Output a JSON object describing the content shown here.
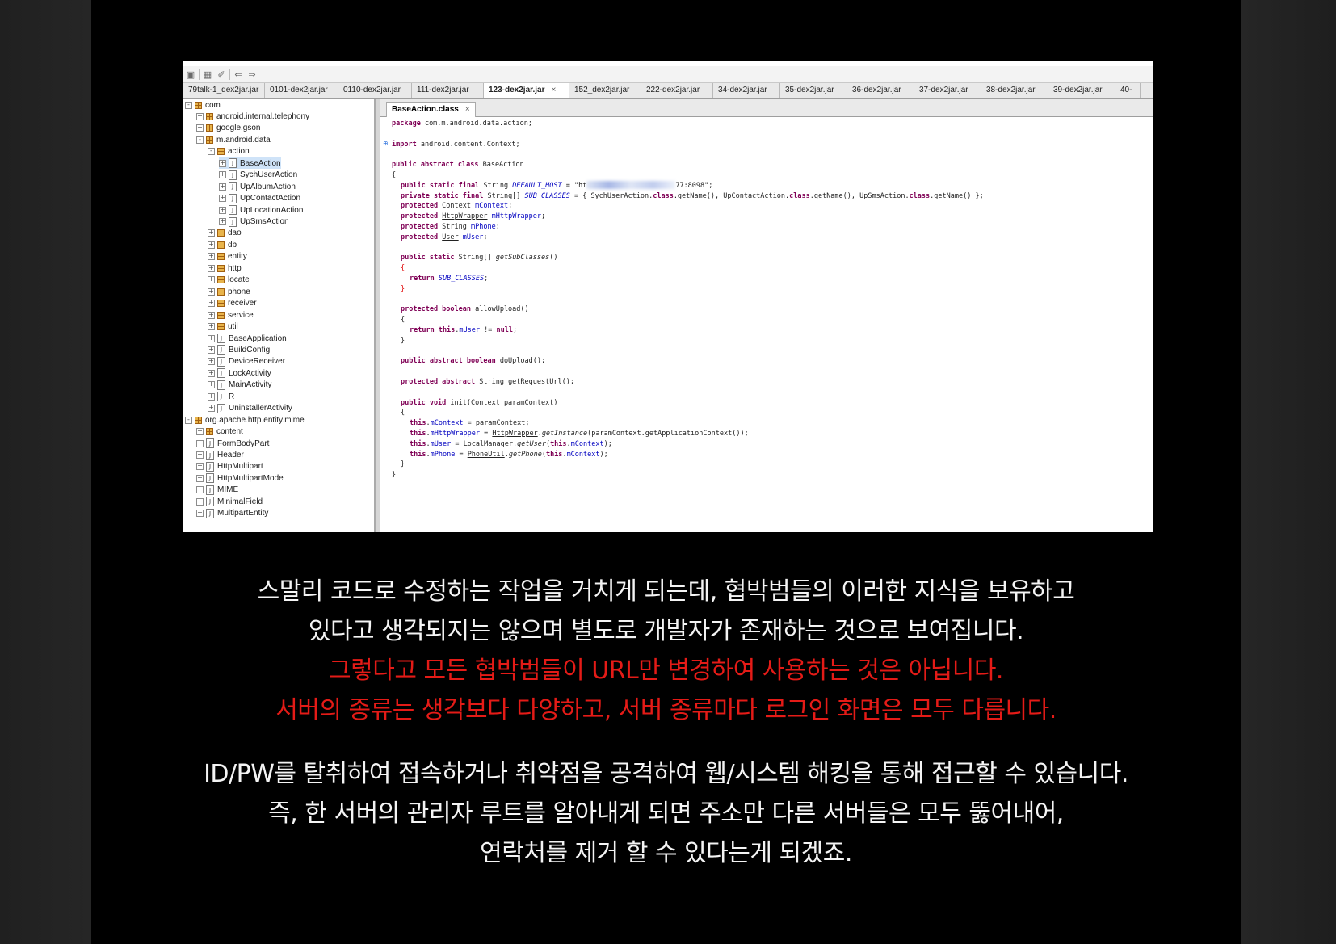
{
  "toolbar_icons": [
    "open-icon",
    "save-all-icon",
    "tool-icon",
    "back-arrow-icon",
    "forward-arrow-icon"
  ],
  "tabs": [
    {
      "label": "79talk-1_dex2jar.jar",
      "active": false
    },
    {
      "label": "0101-dex2jar.jar",
      "active": false
    },
    {
      "label": "0110-dex2jar.jar",
      "active": false
    },
    {
      "label": "111-dex2jar.jar",
      "active": false
    },
    {
      "label": "123-dex2jar.jar",
      "active": true
    },
    {
      "label": "152_dex2jar.jar",
      "active": false
    },
    {
      "label": "222-dex2jar.jar",
      "active": false
    },
    {
      "label": "34-dex2jar.jar",
      "active": false
    },
    {
      "label": "35-dex2jar.jar",
      "active": false
    },
    {
      "label": "36-dex2jar.jar",
      "active": false
    },
    {
      "label": "37-dex2jar.jar",
      "active": false
    },
    {
      "label": "38-dex2jar.jar",
      "active": false
    },
    {
      "label": "39-dex2jar.jar",
      "active": false
    },
    {
      "label": "40-",
      "active": false
    }
  ],
  "tree": [
    {
      "label": "com",
      "type": "pkg",
      "exp": "-",
      "lvl": 0
    },
    {
      "label": "android.internal.telephony",
      "type": "pkg",
      "exp": "+",
      "lvl": 1
    },
    {
      "label": "google.gson",
      "type": "pkg",
      "exp": "+",
      "lvl": 1
    },
    {
      "label": "m.android.data",
      "type": "pkg",
      "exp": "-",
      "lvl": 1
    },
    {
      "label": "action",
      "type": "pkg",
      "exp": "-",
      "lvl": 2
    },
    {
      "label": "BaseAction",
      "type": "cls",
      "exp": "+",
      "lvl": 3,
      "selected": true
    },
    {
      "label": "SychUserAction",
      "type": "cls",
      "exp": "+",
      "lvl": 3
    },
    {
      "label": "UpAlbumAction",
      "type": "cls",
      "exp": "+",
      "lvl": 3
    },
    {
      "label": "UpContactAction",
      "type": "cls",
      "exp": "+",
      "lvl": 3
    },
    {
      "label": "UpLocationAction",
      "type": "cls",
      "exp": "+",
      "lvl": 3
    },
    {
      "label": "UpSmsAction",
      "type": "cls",
      "exp": "+",
      "lvl": 3
    },
    {
      "label": "dao",
      "type": "pkg",
      "exp": "+",
      "lvl": 2
    },
    {
      "label": "db",
      "type": "pkg",
      "exp": "+",
      "lvl": 2
    },
    {
      "label": "entity",
      "type": "pkg",
      "exp": "+",
      "lvl": 2
    },
    {
      "label": "http",
      "type": "pkg",
      "exp": "+",
      "lvl": 2
    },
    {
      "label": "locate",
      "type": "pkg",
      "exp": "+",
      "lvl": 2
    },
    {
      "label": "phone",
      "type": "pkg",
      "exp": "+",
      "lvl": 2
    },
    {
      "label": "receiver",
      "type": "pkg",
      "exp": "+",
      "lvl": 2
    },
    {
      "label": "service",
      "type": "pkg",
      "exp": "+",
      "lvl": 2
    },
    {
      "label": "util",
      "type": "pkg",
      "exp": "+",
      "lvl": 2
    },
    {
      "label": "BaseApplication",
      "type": "cls",
      "exp": "+",
      "lvl": 2
    },
    {
      "label": "BuildConfig",
      "type": "cls",
      "exp": "+",
      "lvl": 2
    },
    {
      "label": "DeviceReceiver",
      "type": "cls",
      "exp": "+",
      "lvl": 2
    },
    {
      "label": "LockActivity",
      "type": "cls",
      "exp": "+",
      "lvl": 2
    },
    {
      "label": "MainActivity",
      "type": "cls",
      "exp": "+",
      "lvl": 2
    },
    {
      "label": "R",
      "type": "cls",
      "exp": "+",
      "lvl": 2
    },
    {
      "label": "UninstallerActivity",
      "type": "cls",
      "exp": "+",
      "lvl": 2
    },
    {
      "label": "org.apache.http.entity.mime",
      "type": "pkg",
      "exp": "-",
      "lvl": 0
    },
    {
      "label": "content",
      "type": "pkg",
      "exp": "+",
      "lvl": 1
    },
    {
      "label": "FormBodyPart",
      "type": "cls",
      "exp": "+",
      "lvl": 1
    },
    {
      "label": "Header",
      "type": "cls",
      "exp": "+",
      "lvl": 1
    },
    {
      "label": "HttpMultipart",
      "type": "cls",
      "exp": "+",
      "lvl": 1
    },
    {
      "label": "HttpMultipartMode",
      "type": "cls",
      "exp": "+",
      "lvl": 1
    },
    {
      "label": "MIME",
      "type": "cls",
      "exp": "+",
      "lvl": 1
    },
    {
      "label": "MinimalField",
      "type": "cls",
      "exp": "+",
      "lvl": 1
    },
    {
      "label": "MultipartEntity",
      "type": "cls",
      "exp": "+",
      "lvl": 1
    }
  ],
  "editor_tab": "BaseAction.class",
  "code_lines": [
    {
      "n": 0,
      "ind": 0,
      "html": "<span class=\"kw\">package</span> com.m.android.data.action;"
    },
    {
      "n": 2,
      "ind": 0,
      "html": "<span class=\"kw\">import</span> android.content.Context;",
      "fold": true
    },
    {
      "n": 4,
      "ind": 0,
      "html": "<span class=\"kw\">public abstract class</span> BaseAction"
    },
    {
      "n": 5,
      "ind": 0,
      "html": "{"
    },
    {
      "n": 6,
      "ind": 1,
      "html": "<span class=\"kw\">public static final</span> String <span class=\"it\">DEFAULT_HOST</span> = \"ht<span class=\"blur\"></span>77:8098\";"
    },
    {
      "n": 7,
      "ind": 1,
      "html": "<span class=\"kw\">private static final</span> String[] <span class=\"it\">SUB_CLASSES</span> = { <span class=\"ty\">SychUserAction</span>.<span class=\"kw\">class</span>.getName(), <span class=\"ty\">UpContactAction</span>.<span class=\"kw\">class</span>.getName(), <span class=\"ty\">UpSmsAction</span>.<span class=\"kw\">class</span>.getName() };"
    },
    {
      "n": 8,
      "ind": 1,
      "html": "<span class=\"kw\">protected</span> Context <span class=\"fld\">mContext</span>;"
    },
    {
      "n": 9,
      "ind": 1,
      "html": "<span class=\"kw\">protected</span> <span class=\"ty\">HttpWrapper</span> <span class=\"fld\">mHttpWrapper</span>;"
    },
    {
      "n": 10,
      "ind": 1,
      "html": "<span class=\"kw\">protected</span> String <span class=\"fld\">mPhone</span>;"
    },
    {
      "n": 11,
      "ind": 1,
      "html": "<span class=\"kw\">protected</span> <span class=\"ty\">User</span> <span class=\"fld\">mUser</span>;"
    },
    {
      "n": 13,
      "ind": 1,
      "html": "<span class=\"kw\">public static</span> String[] <i>getSubClasses</i>()"
    },
    {
      "n": 14,
      "ind": 1,
      "html": "<span class=\"red\">{</span>"
    },
    {
      "n": 15,
      "ind": 2,
      "html": "<span class=\"kw\">return</span> <span class=\"it\">SUB_CLASSES</span>;"
    },
    {
      "n": 16,
      "ind": 1,
      "html": "<span class=\"red\">}</span>"
    },
    {
      "n": 18,
      "ind": 1,
      "html": "<span class=\"kw\">protected boolean</span> allowUpload()"
    },
    {
      "n": 19,
      "ind": 1,
      "html": "{"
    },
    {
      "n": 20,
      "ind": 2,
      "html": "<span class=\"kw\">return this</span>.<span class=\"fld\">mUser</span> != <span class=\"kw\">null</span>;"
    },
    {
      "n": 21,
      "ind": 1,
      "html": "}"
    },
    {
      "n": 23,
      "ind": 1,
      "html": "<span class=\"kw\">public abstract boolean</span> doUpload();"
    },
    {
      "n": 25,
      "ind": 1,
      "html": "<span class=\"kw\">protected abstract</span> String getRequestUrl();"
    },
    {
      "n": 27,
      "ind": 1,
      "html": "<span class=\"kw\">public void</span> init(Context paramContext)"
    },
    {
      "n": 28,
      "ind": 1,
      "html": "{"
    },
    {
      "n": 29,
      "ind": 2,
      "html": "<span class=\"kw\">this</span>.<span class=\"fld\">mContext</span> = paramContext;"
    },
    {
      "n": 30,
      "ind": 2,
      "html": "<span class=\"kw\">this</span>.<span class=\"fld\">mHttpWrapper</span> = <span class=\"ty\">HttpWrapper</span>.<i>getInstance</i>(paramContext.getApplicationContext());"
    },
    {
      "n": 31,
      "ind": 2,
      "html": "<span class=\"kw\">this</span>.<span class=\"fld\">mUser</span> = <span class=\"ty\">LocalManager</span>.<i>getUser</i>(<span class=\"kw\">this</span>.<span class=\"fld\">mContext</span>);"
    },
    {
      "n": 32,
      "ind": 2,
      "html": "<span class=\"kw\">this</span>.<span class=\"fld\">mPhone</span> = <span class=\"ty\">PhoneUtil</span>.<i>getPhone</i>(<span class=\"kw\">this</span>.<span class=\"fld\">mContext</span>);"
    },
    {
      "n": 33,
      "ind": 1,
      "html": "}"
    },
    {
      "n": 34,
      "ind": 0,
      "html": "}"
    }
  ],
  "captions": {
    "line1": "스말리 코드로 수정하는 작업을 거치게 되는데, 협박범들의 이러한 지식을 보유하고",
    "line2": "있다고 생각되지는 않으며 별도로 개발자가 존재하는 것으로 보여집니다.",
    "line3": "그렇다고 모든 협박범들이 URL만 변경하여 사용하는 것은 아닙니다.",
    "line4": "서버의 종류는 생각보다 다양하고, 서버 종류마다 로그인 화면은 모두 다릅니다.",
    "line5": "ID/PW를 탈취하여 접속하거나 취약점을 공격하여 웹/시스템 해킹을 통해 접근할 수 있습니다.",
    "line6": "즉, 한 서버의 관리자 루트를 알아내게 되면 주소만 다른 서버들은 모두 뚫어내어,",
    "line7": "연락처를 제거 할 수 있다는게 되겠죠."
  },
  "colors": {
    "caption_white": "#f4f4f4",
    "caption_red": "#e41b17",
    "background": "#000000"
  }
}
